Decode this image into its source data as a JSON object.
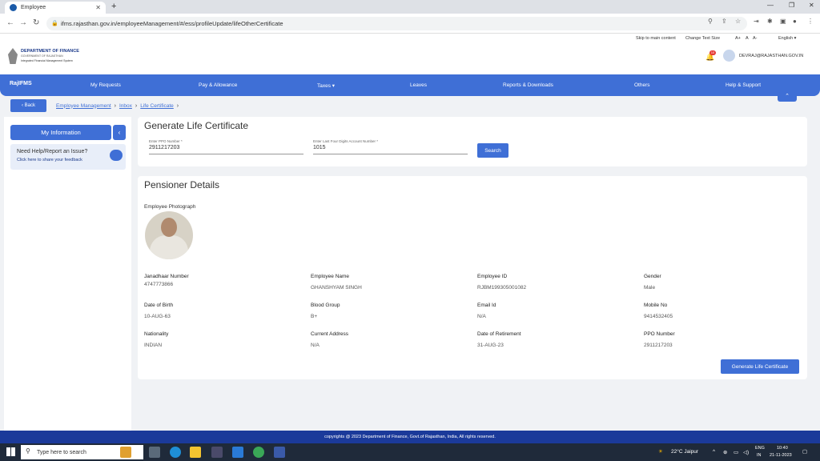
{
  "browser": {
    "tab_title": "Employee",
    "url": "ifms.rajasthan.gov.in/employeeManagement/#/ess/profileUpdate/lifeOtherCertificate"
  },
  "utility": {
    "skip": "Skip to main content",
    "change_text": "Change Text Size",
    "sizes": [
      "A+",
      "A",
      "A-"
    ],
    "language": "English ▾"
  },
  "header": {
    "dept_title": "DEPARTMENT OF FINANCE",
    "dept_sub": "GOVERNMENT OF RAJASTHAN",
    "system_name": "Integrated Financial Management System",
    "notif_count": "10",
    "user_email": "DEVRAJ@RAJASTHAN.GOV.IN"
  },
  "menu": {
    "logo": "RajIFMS",
    "items": [
      "My Requests",
      "Pay & Allowance",
      "Taxes ▾",
      "Leaves",
      "Reports & Downloads",
      "Others",
      "Help & Support"
    ]
  },
  "breadcrumb": {
    "back": "‹  Back",
    "items": [
      "Employee Management",
      "Inbox",
      "Life Certificate"
    ]
  },
  "sidebar": {
    "my_information": "My Information",
    "help_title": "Need Help/Report an Issue?",
    "help_link": "Click here to share your feedback"
  },
  "generate": {
    "title": "Generate Life Certificate",
    "ppo_label": "Enter PPO Number *",
    "ppo_value": "2911217203",
    "acct_label": "Enter Last Four Digits Account Number *",
    "acct_value": "1015",
    "search_btn": "Search"
  },
  "pensioner": {
    "title": "Pensioner Details",
    "photo_label": "Employee Photograph",
    "fields": [
      {
        "label": "Janadhaar Number",
        "value": "4747773866"
      },
      {
        "label": "Employee Name",
        "value": "GHANSHYAM SINGH"
      },
      {
        "label": "Employee ID",
        "value": "RJBM199305001082"
      },
      {
        "label": "Gender",
        "value": "Male"
      },
      {
        "label": "Date of Birth",
        "value": "10-AUG-63"
      },
      {
        "label": "Blood Group",
        "value": "B+"
      },
      {
        "label": "Email Id",
        "value": "N/A"
      },
      {
        "label": "Mobile No",
        "value": "9414532405"
      },
      {
        "label": "Nationality",
        "value": "INDIAN"
      },
      {
        "label": "Current Address",
        "value": "N/A"
      },
      {
        "label": "Date of Retirement",
        "value": "31-AUG-23"
      },
      {
        "label": "PPO Number",
        "value": "2911217203"
      }
    ],
    "generate_btn": "Generate Life Certificate"
  },
  "footer": "copyrights @ 2023 Department of Finance, Govt.of Rajasthan, India, All rights reserved.",
  "taskbar": {
    "search": "Type here to search",
    "weather": "22°C  Jaipur",
    "lang1": "ENG",
    "lang2": "IN",
    "time": "10:40",
    "date": "21-11-2023"
  }
}
